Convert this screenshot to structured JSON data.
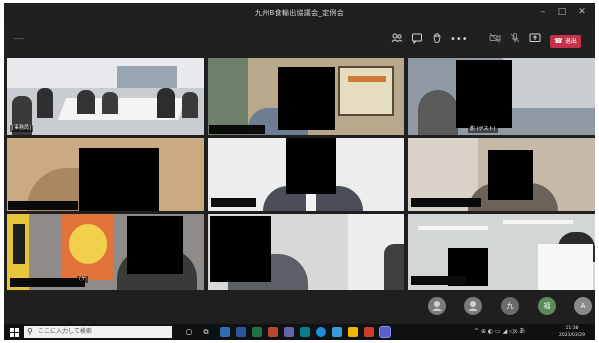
{
  "window": {
    "title": "九州B食輸出協議会_定例会",
    "minimize": "–",
    "maximize": "□",
    "close": "✕"
  },
  "toolbar": {
    "timer": "----",
    "leave_label": "退出",
    "leave_color": "#c4314b",
    "icons": [
      "participants-icon",
      "chat-icon",
      "raise-hand-icon",
      "more-icon",
      "camera-icon",
      "microphone-icon",
      "share-screen-icon"
    ]
  },
  "tiles": {
    "t1_label": "[事務局]",
    "t6_label": "影 (ゲスト)",
    "t10_label": "(ゲ"
  },
  "avatars": [
    {
      "text": "",
      "color": "#7a7a7a"
    },
    {
      "text": "",
      "color": "#7a7a7a"
    },
    {
      "text": "九",
      "color": "#6b6b6b"
    },
    {
      "text": "福",
      "color": "#5c8a5c"
    },
    {
      "text": "A",
      "color": "#8a8a8a"
    }
  ],
  "taskbar": {
    "search_placeholder": "ここに入力して検索",
    "time": "11:38",
    "date": "2021/03/29"
  }
}
